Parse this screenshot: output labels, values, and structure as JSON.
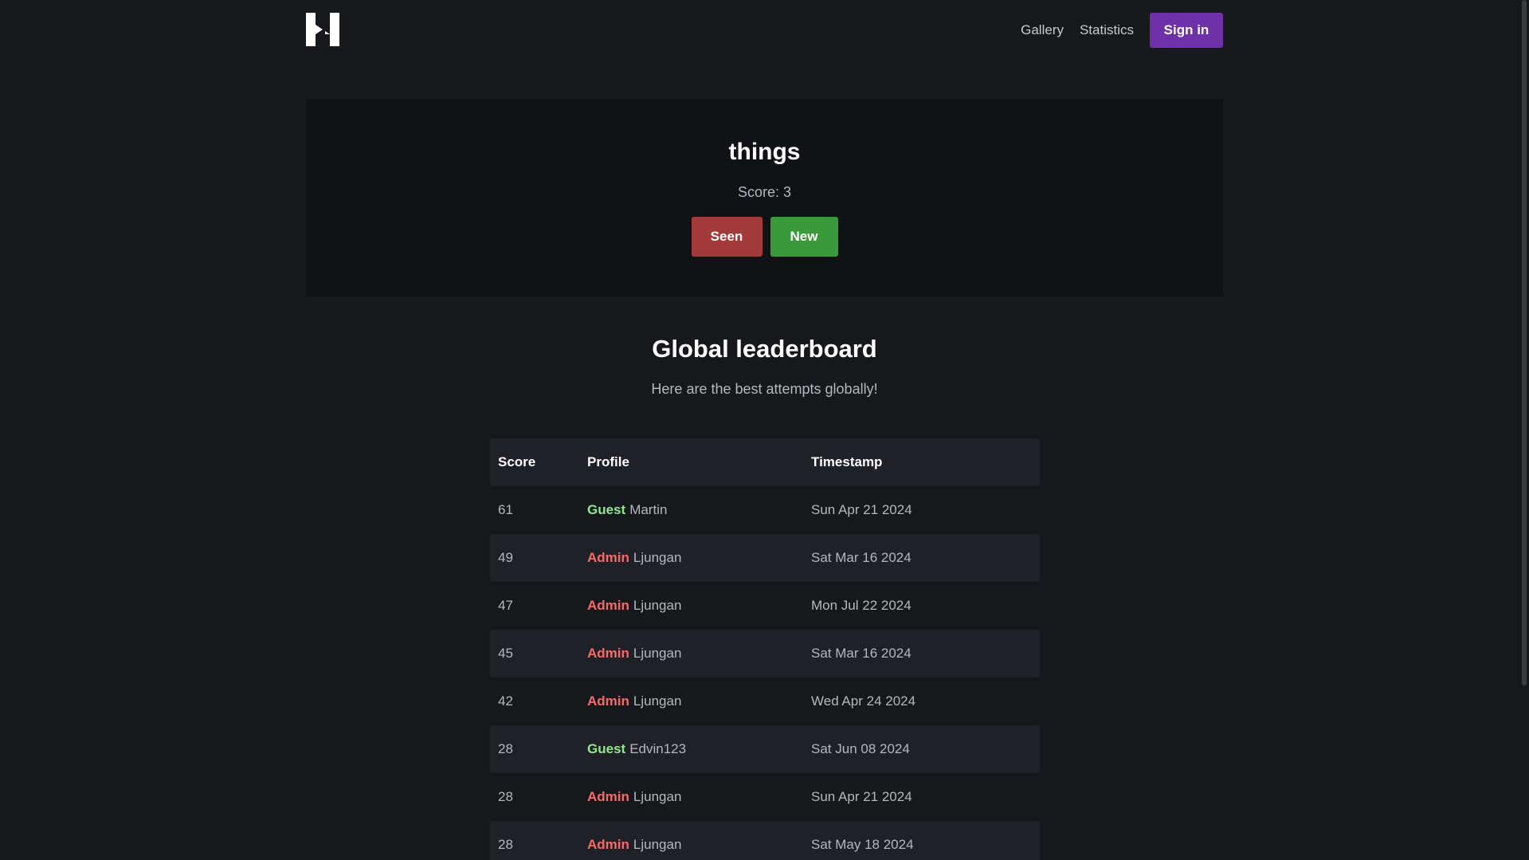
{
  "header": {
    "logo_icon": "h-letter-logo-icon",
    "nav": {
      "gallery": "Gallery",
      "statistics": "Statistics",
      "signin": "Sign in"
    }
  },
  "game": {
    "word": "things",
    "score_text": "Score: 3",
    "seen_label": "Seen",
    "new_label": "New"
  },
  "leaderboard": {
    "title": "Global leaderboard",
    "subtitle": "Here are the best attempts globally!",
    "columns": {
      "score": "Score",
      "profile": "Profile",
      "timestamp": "Timestamp"
    },
    "rows": [
      {
        "score": "61",
        "role": "Guest",
        "name": "Martin",
        "timestamp": "Sun Apr 21 2024"
      },
      {
        "score": "49",
        "role": "Admin",
        "name": "Ljungan",
        "timestamp": "Sat Mar 16 2024"
      },
      {
        "score": "47",
        "role": "Admin",
        "name": "Ljungan",
        "timestamp": "Mon Jul 22 2024"
      },
      {
        "score": "45",
        "role": "Admin",
        "name": "Ljungan",
        "timestamp": "Sat Mar 16 2024"
      },
      {
        "score": "42",
        "role": "Admin",
        "name": "Ljungan",
        "timestamp": "Wed Apr 24 2024"
      },
      {
        "score": "28",
        "role": "Guest",
        "name": "Edvin123",
        "timestamp": "Sat Jun 08 2024"
      },
      {
        "score": "28",
        "role": "Admin",
        "name": "Ljungan",
        "timestamp": "Sun Apr 21 2024"
      },
      {
        "score": "28",
        "role": "Admin",
        "name": "Ljungan",
        "timestamp": "Sat May 18 2024"
      }
    ]
  },
  "colors": {
    "background": "#17181c",
    "card": "#111216",
    "signin": "#6e31a8",
    "seen": "#a33a3a",
    "new": "#3a9a3a",
    "guest": "#8fe88f",
    "admin": "#f26c6c"
  }
}
